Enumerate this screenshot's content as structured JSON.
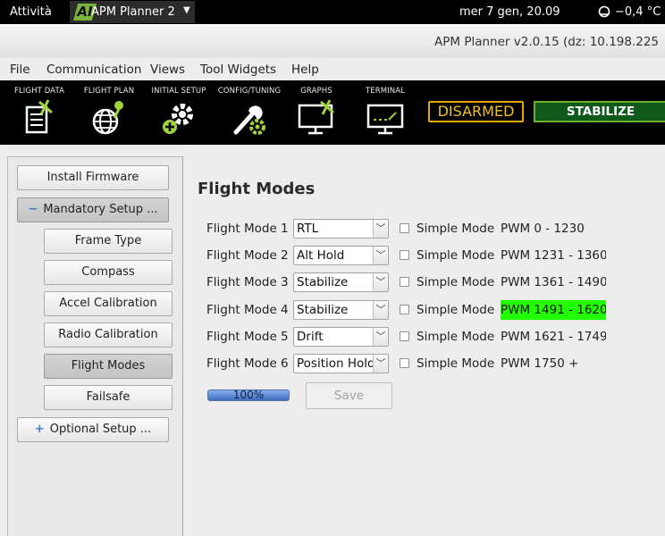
{
  "topbar": {
    "activities": "Attività",
    "app_logo": "AI",
    "app_name": "APM Planner 2",
    "app_caret": "▼",
    "clock": "mer  7 gen, 20.09",
    "weather": "−0,4 °C"
  },
  "window": {
    "title": "APM Planner v2.0.15 (dz: 10.198.225"
  },
  "menubar": {
    "items": [
      "File",
      "Communication",
      "Views",
      "Tool Widgets",
      "Help"
    ]
  },
  "toolbar": {
    "buttons": [
      {
        "label": "FLIGHT DATA",
        "icon": "flight-data-icon"
      },
      {
        "label": "FLIGHT PLAN",
        "icon": "flight-plan-icon"
      },
      {
        "label": "INITIAL SETUP",
        "icon": "initial-setup-icon"
      },
      {
        "label": "CONFIG/TUNING",
        "icon": "config-tuning-icon"
      },
      {
        "label": "GRAPHS",
        "icon": "graphs-icon"
      },
      {
        "label": "TERMINAL",
        "icon": "terminal-icon"
      }
    ],
    "arm_status": "DISARMED",
    "mode_status": "STABILIZE"
  },
  "sidebar": {
    "install_firmware": "Install Firmware",
    "mandatory_setup": "Mandatory Setup ...",
    "mandatory_symbol": "−",
    "mandatory_items": [
      "Frame Type",
      "Compass",
      "Accel Calibration",
      "Radio Calibration",
      "Flight Modes",
      "Failsafe"
    ],
    "active_item": "Flight Modes",
    "optional_setup": "Optional Setup ...",
    "optional_symbol": "+"
  },
  "main": {
    "title": "Flight Modes",
    "simple_mode_label": "Simple Mode",
    "modes": [
      {
        "label": "Flight Mode 1",
        "value": "RTL",
        "pwm": "PWM 0 - 1230",
        "simple": false,
        "current": false
      },
      {
        "label": "Flight Mode 2",
        "value": "Alt Hold",
        "pwm": "PWM 1231 - 1360",
        "simple": false,
        "current": false
      },
      {
        "label": "Flight Mode 3",
        "value": "Stabilize",
        "pwm": "PWM 1361 - 1490",
        "simple": false,
        "current": false
      },
      {
        "label": "Flight Mode 4",
        "value": "Stabilize",
        "pwm": "PWM 1491 - 1620",
        "simple": false,
        "current": true
      },
      {
        "label": "Flight Mode 5",
        "value": "Drift",
        "pwm": "PWM 1621 - 1749",
        "simple": false,
        "current": false
      },
      {
        "label": "Flight Mode 6",
        "value": "Position Hold",
        "pwm": "PWM 1750 +",
        "simple": false,
        "current": false
      }
    ],
    "progress_percent": 100,
    "progress_label": "100%",
    "save_label": "Save"
  },
  "colors": {
    "current_mode_highlight": "#22ff00",
    "disarmed": "#f3c21b",
    "mode_badge": "#0f5a1b",
    "accent_green": "#7ab43a"
  }
}
